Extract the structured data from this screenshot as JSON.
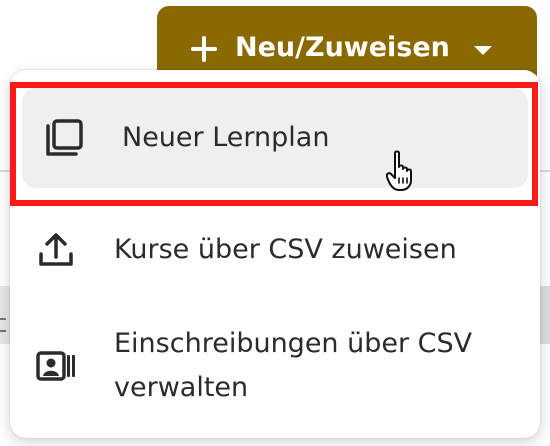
{
  "primary_button": {
    "label": "Neu/Zuweisen",
    "icon": "plus-icon",
    "dropdown_icon": "caret-down-icon",
    "color": "#8a6a00"
  },
  "menu": {
    "items": [
      {
        "label": "Neuer Lernplan",
        "icon": "copy-stack-icon",
        "highlighted": true
      },
      {
        "label": "Kurse über CSV zuweisen",
        "icon": "upload-icon"
      },
      {
        "label_line1": "Einschreibungen über CSV",
        "label_line2": "verwalten",
        "icon": "id-card-icon"
      }
    ]
  },
  "highlight_color": "#ff1a1a",
  "pointer": "hand-pointer-icon"
}
